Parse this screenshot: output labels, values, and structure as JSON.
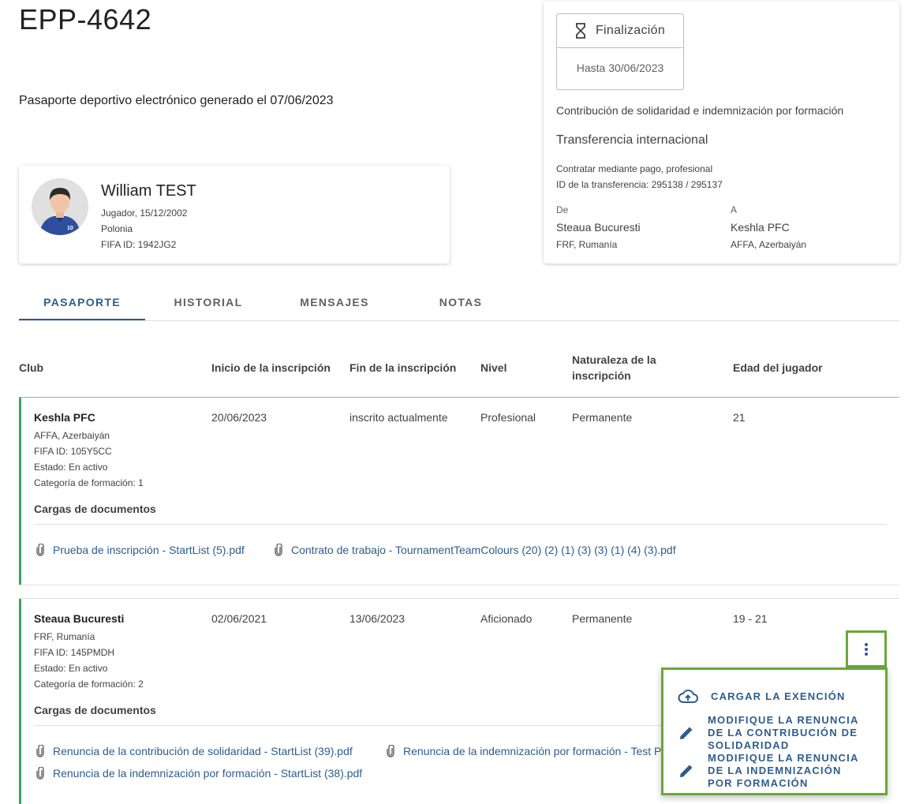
{
  "header": {
    "title": "EPP-4642",
    "subtitle": "Pasaporte deportivo electrónico generado el 07/06/2023"
  },
  "player": {
    "name": "William TEST",
    "role_dob": "Jugador, 15/12/2002",
    "country": "Polonia",
    "fifa_id": "FIFA ID: 1942JG2",
    "jersey_number": "10"
  },
  "transfer": {
    "status_label": "Finalización",
    "status_date": "Hasta 30/06/2023",
    "contribution": "Contribución de solidaridad e indemnización por formación",
    "type": "Transferencia internacional",
    "contract": "Contratar mediante pago, profesional",
    "transfer_id": "ID de la transferencia: 295138 / 295137",
    "from_label": "De",
    "from_club": "Steaua Bucuresti",
    "from_assoc": "FRF, Rumanía",
    "to_label": "A",
    "to_club": "Keshla PFC",
    "to_assoc": "AFFA, Azerbaiyán"
  },
  "tabs": [
    "PASAPORTE",
    "HISTORIAL",
    "MENSAJES",
    "NOTAS"
  ],
  "table": {
    "headers": {
      "club": "Club",
      "start": "Inicio de la inscripción",
      "end": "Fin de la inscripción",
      "level": "Nivel",
      "nature_1": "Naturaleza de la",
      "nature_2": "inscripción",
      "age": "Edad del jugador"
    },
    "rows": [
      {
        "club": "Keshla PFC",
        "assoc": "AFFA, Azerbaiyán",
        "fifa_id": "FIFA ID: 105Y5CC",
        "status": "Estado: En activo",
        "category": "Categoría de formación: 1",
        "start": "20/06/2023",
        "end": "inscrito actualmente",
        "level": "Profesional",
        "nature": "Permanente",
        "age": "21",
        "docs_title": "Cargas de documentos",
        "docs": [
          "Prueba de inscripción - StartList (5).pdf",
          "Contrato de trabajo - TournamentTeamColours (20) (2) (1) (3) (3) (1) (4) (3).pdf"
        ]
      },
      {
        "club": "Steaua Bucuresti",
        "assoc": "FRF, Rumanía",
        "fifa_id": "FIFA ID: 145PMDH",
        "status": "Estado: En activo",
        "category": "Categoría de formación: 2",
        "start": "02/06/2021",
        "end": "13/06/2023",
        "level": "Aficionado",
        "nature": "Permanente",
        "age": "19 - 21",
        "docs_title": "Cargas de documentos",
        "docs": [
          "Renuncia de la contribución de solidaridad - StartList (39).pdf",
          "Renuncia de la indemnización por formación - Test P",
          "Renuncia de la indemnización por formación - StartList (38).pdf"
        ]
      }
    ]
  },
  "menu": {
    "items": [
      {
        "label": "CARGAR LA EXENCIÓN",
        "icon": "cloud-upload-icon"
      },
      {
        "label_lines": [
          "MODIFIQUE LA RENUNCIA",
          "DE LA CONTRIBUCIÓN DE",
          "SOLIDARIDAD"
        ],
        "icon": "pencil-icon"
      },
      {
        "label_lines": [
          "MODIFIQUE LA RENUNCIA",
          "DE LA INDEMNIZACIÓN",
          "POR FORMACIÓN"
        ],
        "icon": "pencil-icon"
      }
    ]
  },
  "colors": {
    "accent": "#2c5d8f",
    "row_border": "#3aa35c",
    "highlight": "#6aa83a"
  }
}
